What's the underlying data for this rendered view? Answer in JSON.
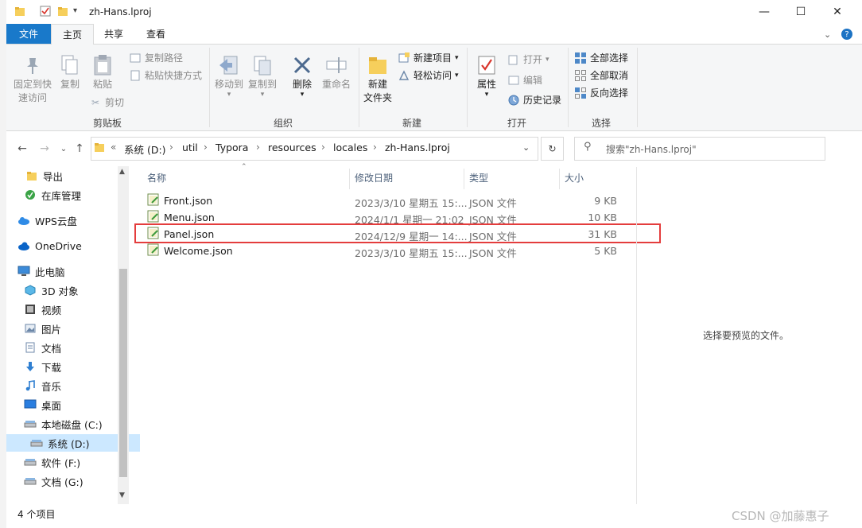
{
  "window": {
    "title": "zh-Hans.lproj"
  },
  "tabs": [
    "文件",
    "主页",
    "共享",
    "查看"
  ],
  "ribbon": {
    "clipboard": {
      "label": "剪贴板",
      "pin": [
        "固定到快",
        "速访问"
      ],
      "copy": "复制",
      "paste": "粘贴",
      "copy_path": "复制路径",
      "paste_shortcut": "粘贴快捷方式",
      "cut": "剪切"
    },
    "organize": {
      "label": "组织",
      "move_to": "移动到",
      "copy_to": "复制到",
      "delete": "删除",
      "rename": "重命名"
    },
    "new": {
      "label": "新建",
      "new_folder": [
        "新建",
        "文件夹"
      ],
      "new_item": "新建项目",
      "easy_access": "轻松访问"
    },
    "open": {
      "label": "打开",
      "properties": "属性",
      "open": "打开",
      "edit": "编辑",
      "history": "历史记录"
    },
    "select": {
      "label": "选择",
      "select_all": "全部选择",
      "select_none": "全部取消",
      "invert": "反向选择"
    }
  },
  "address": {
    "crumbs": [
      "系统 (D:)",
      "util",
      "Typora",
      "resources",
      "locales",
      "zh-Hans.lproj"
    ],
    "prefix": "«"
  },
  "search": {
    "placeholder": "搜索\"zh-Hans.lproj\""
  },
  "nav_pane": {
    "items": [
      {
        "label": "导出",
        "icon": "folder-icon"
      },
      {
        "label": "在库管理",
        "icon": "app-icon"
      },
      {
        "label": "WPS云盘",
        "icon": "cloud-icon"
      },
      {
        "label": "OneDrive",
        "icon": "onedrive-icon"
      },
      {
        "label": "此电脑",
        "icon": "pc-icon"
      },
      {
        "label": "3D 对象",
        "icon": "3d-icon"
      },
      {
        "label": "视频",
        "icon": "video-icon"
      },
      {
        "label": "图片",
        "icon": "picture-icon"
      },
      {
        "label": "文档",
        "icon": "document-icon"
      },
      {
        "label": "下载",
        "icon": "download-icon"
      },
      {
        "label": "音乐",
        "icon": "music-icon"
      },
      {
        "label": "桌面",
        "icon": "desktop-icon"
      },
      {
        "label": "本地磁盘 (C:)",
        "icon": "drive-icon"
      },
      {
        "label": "系统 (D:)",
        "icon": "drive-icon"
      },
      {
        "label": "软件 (F:)",
        "icon": "drive-icon"
      },
      {
        "label": "文档 (G:)",
        "icon": "drive-icon"
      }
    ]
  },
  "columns": {
    "name": "名称",
    "date": "修改日期",
    "type": "类型",
    "size": "大小"
  },
  "files": [
    {
      "name": "Front.json",
      "date": "2023/3/10 星期五 15:...",
      "type": "JSON 文件",
      "size": "9 KB"
    },
    {
      "name": "Menu.json",
      "date": "2024/1/1 星期一 21:02",
      "type": "JSON 文件",
      "size": "10 KB"
    },
    {
      "name": "Panel.json",
      "date": "2024/12/9 星期一 14:...",
      "type": "JSON 文件",
      "size": "31 KB"
    },
    {
      "name": "Welcome.json",
      "date": "2023/3/10 星期五 15:...",
      "type": "JSON 文件",
      "size": "5 KB"
    }
  ],
  "preview": {
    "text": "选择要预览的文件。"
  },
  "status": {
    "count": "4 个项目"
  },
  "watermark": "CSDN @加藤惠子"
}
